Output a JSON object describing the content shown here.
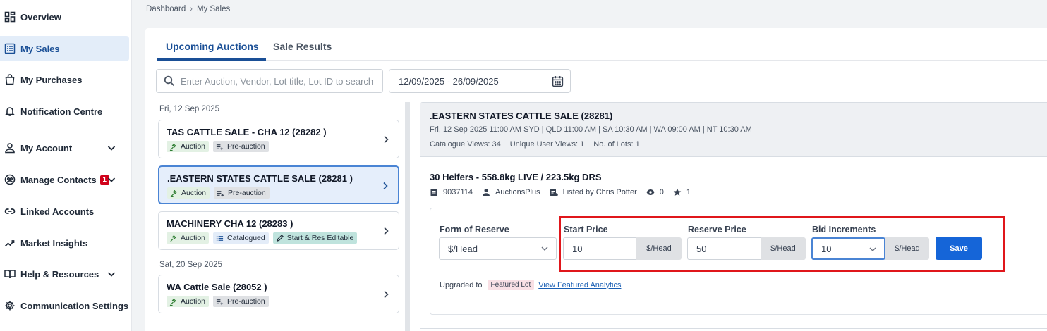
{
  "sidebar": {
    "items": [
      {
        "label": "Overview"
      },
      {
        "label": "My Sales"
      },
      {
        "label": "My Purchases"
      },
      {
        "label": "Notification Centre"
      },
      {
        "label": "My Account"
      },
      {
        "label": "Manage Contacts",
        "badge": "1"
      },
      {
        "label": "Linked Accounts"
      },
      {
        "label": "Market Insights"
      },
      {
        "label": "Help & Resources"
      },
      {
        "label": "Communication Settings"
      }
    ]
  },
  "breadcrumb": {
    "root": "Dashboard",
    "current": "My Sales"
  },
  "tabs": {
    "upcoming": "Upcoming Auctions",
    "results": "Sale Results"
  },
  "search": {
    "placeholder": "Enter Auction, Vendor, Lot title, Lot ID to search",
    "value": ""
  },
  "date_range": {
    "value": "12/09/2025 - 26/09/2025"
  },
  "list": {
    "groups": [
      {
        "date": "Fri, 12 Sep 2025",
        "items": [
          {
            "title": "TAS CATTLE SALE - CHA 12 (28282 )",
            "tags": [
              "Auction",
              "Pre-auction"
            ]
          },
          {
            "title": ".EASTERN STATES CATTLE SALE (28281 )",
            "tags": [
              "Auction",
              "Pre-auction"
            ]
          },
          {
            "title": "MACHINERY CHA 12 (28283 )",
            "tags": [
              "Auction",
              "Catalogued",
              "Start & Res Editable"
            ]
          }
        ]
      },
      {
        "date": "Sat, 20 Sep 2025",
        "items": [
          {
            "title": "WA Cattle Sale (28052 )",
            "tags": [
              "Auction",
              "Pre-auction"
            ]
          }
        ]
      }
    ]
  },
  "detail": {
    "title": ".EASTERN STATES CATTLE SALE (28281)",
    "time": "Fri, 12 Sep 2025 11:00 AM SYD | QLD 11:00 AM | SA 10:30 AM | WA 09:00 AM | NT 10:30 AM",
    "stats": {
      "catalogue_views": "Catalogue Views: 34",
      "unique_views": "Unique User Views: 1",
      "lots": "No. of Lots: 1"
    },
    "lot": {
      "title": "30 Heifers - 558.8kg LIVE / 223.5kg DRS",
      "id": "9037114",
      "vendor": "AuctionsPlus",
      "listed_by": "Listed by Chris Potter",
      "views": "0",
      "stars": "1"
    },
    "form": {
      "form_of_reserve_label": "Form of Reserve",
      "form_of_reserve_value": "$/Head",
      "start_price_label": "Start Price",
      "start_price_value": "10",
      "start_price_unit": "$/Head",
      "reserve_price_label": "Reserve Price",
      "reserve_price_value": "50",
      "reserve_price_unit": "$/Head",
      "bid_increments_label": "Bid Increments",
      "bid_increments_value": "10",
      "bid_increments_unit": "$/Head",
      "save_label": "Save"
    },
    "upgrade": {
      "prefix": "Upgraded to",
      "tag": "Featured Lot",
      "link": "View Featured Analytics"
    }
  },
  "colors": {
    "accent": "#1a4f96",
    "save_button": "#1565d8",
    "highlight_border": "#e0161b",
    "selected_card_bg": "#e5eefb"
  }
}
